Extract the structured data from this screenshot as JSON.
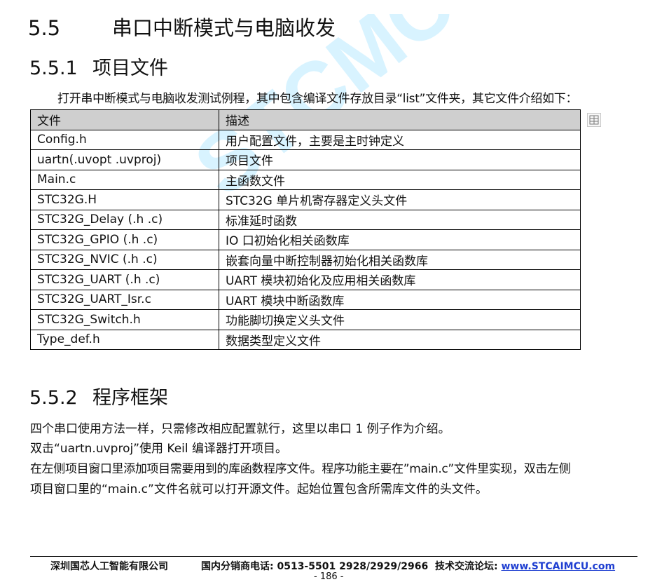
{
  "watermark": "STCMCU",
  "section": {
    "number": "5.5",
    "title": "串口中断模式与电脑收发"
  },
  "subsections": [
    {
      "number": "5.5.1",
      "title": "项目文件"
    },
    {
      "number": "5.5.2",
      "title": "程序框架"
    }
  ],
  "intro": "打开串中断模式与电脑收发测试例程，其中包含编译文件存放目录“list”文件夹，其它文件介绍如下：",
  "table": {
    "headers": [
      "文件",
      "描述"
    ],
    "rows": [
      [
        "Config.h",
        "用户配置文件，主要是主时钟定义"
      ],
      [
        "uartn(.uvopt .uvproj)",
        "项目文件"
      ],
      [
        "Main.c",
        "主函数文件"
      ],
      [
        "STC32G.H",
        "STC32G 单片机寄存器定义头文件"
      ],
      [
        "STC32G_Delay (.h .c)",
        "标准延时函数"
      ],
      [
        "STC32G_GPIO (.h .c)",
        "IO 口初始化相关函数库"
      ],
      [
        "STC32G_NVIC (.h .c)",
        "嵌套向量中断控制器初始化相关函数库"
      ],
      [
        "STC32G_UART (.h .c)",
        "UART 模块初始化及应用相关函数库"
      ],
      [
        "STC32G_UART_Isr.c",
        "UART 模块中断函数库"
      ],
      [
        "STC32G_Switch.h",
        "功能脚切换定义头文件"
      ],
      [
        "Type_def.h",
        "数据类型定义文件"
      ]
    ]
  },
  "paragraphs": [
    "四个串口使用方法一样，只需修改相应配置就行，这里以串口 1 例子作为介绍。",
    "双击“uartn.uvproj”使用 Keil 编译器打开项目。",
    "在左侧项目窗口里添加项目需要用到的库函数程序文件。程序功能主要在”main.c”文件里实现，双击左侧",
    "项目窗口里的“main.c”文件名就可以打开源文件。起始位置包含所需库文件的头文件。"
  ],
  "footer": {
    "company": "深圳国芯人工智能有限公司",
    "phone": "国内分销商电话: 0513-5501 2928/2929/2966",
    "forum_label": "技术交流论坛: ",
    "forum_url": "www.STCAIMCU.com",
    "page": "- 186 -"
  }
}
